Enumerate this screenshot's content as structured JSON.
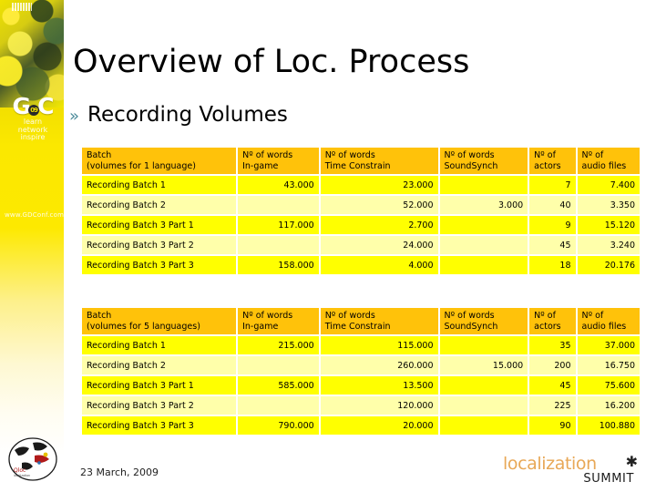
{
  "slide": {
    "title": "Overview of Loc. Process",
    "bullet_marker": "»",
    "bullet_text": "Recording Volumes",
    "date": "23 March, 2009"
  },
  "branding": {
    "gdc_name": "GDC",
    "gdc_badge": "09",
    "gdc_tagline_line1": "learn",
    "gdc_tagline_line2": "network",
    "gdc_tagline_line3": "inspire",
    "gdc_url": "www.GDConf.com",
    "summit_word1": "localization",
    "summit_word2": "SUMMIT",
    "accent_gold": "#ffc20a",
    "accent_yellow": "#ffff00",
    "accent_pale_yellow": "#ffffaa",
    "accent_bullet": "#4a8a99",
    "accent_orange": "#e8a857"
  },
  "table_one": {
    "headers": [
      {
        "line1": "Batch",
        "line2": "(volumes for 1 language)"
      },
      {
        "line1": "Nº of words",
        "line2": "In-game"
      },
      {
        "line1": "Nº of words",
        "line2": "Time Constrain"
      },
      {
        "line1": "Nº of words",
        "line2": "SoundSynch"
      },
      {
        "line1": "Nº of",
        "line2": "actors"
      },
      {
        "line1": "Nº of",
        "line2": "audio files"
      }
    ],
    "rows": [
      {
        "batch": "Recording Batch 1",
        "ingame": "43.000",
        "time": "23.000",
        "sound": "",
        "actors": "7",
        "audio": "7.400"
      },
      {
        "batch": "Recording Batch 2",
        "ingame": "",
        "time": "52.000",
        "sound": "3.000",
        "actors": "40",
        "audio": "3.350"
      },
      {
        "batch": "Recording Batch 3 Part 1",
        "ingame": "117.000",
        "time": "2.700",
        "sound": "",
        "actors": "9",
        "audio": "15.120"
      },
      {
        "batch": "Recording Batch 3 Part 2",
        "ingame": "",
        "time": "24.000",
        "sound": "",
        "actors": "45",
        "audio": "3.240"
      },
      {
        "batch": "Recording Batch 3 Part 3",
        "ingame": "158.000",
        "time": "4.000",
        "sound": "",
        "actors": "18",
        "audio": "20.176"
      }
    ]
  },
  "table_two": {
    "headers": [
      {
        "line1": "Batch",
        "line2": "(volumes for 5 languages)"
      },
      {
        "line1": "Nº of words",
        "line2": "In-game"
      },
      {
        "line1": "Nº of words",
        "line2": "Time Constrain"
      },
      {
        "line1": "Nº of words",
        "line2": "SoundSynch"
      },
      {
        "line1": "Nº of",
        "line2": "actors"
      },
      {
        "line1": "Nº of",
        "line2": "audio files"
      }
    ],
    "rows": [
      {
        "batch": "Recording Batch 1",
        "ingame": "215.000",
        "time": "115.000",
        "sound": "",
        "actors": "35",
        "audio": "37.000"
      },
      {
        "batch": "Recording Batch 2",
        "ingame": "",
        "time": "260.000",
        "sound": "15.000",
        "actors": "200",
        "audio": "16.750"
      },
      {
        "batch": "Recording Batch 3 Part 1",
        "ingame": "585.000",
        "time": "13.500",
        "sound": "",
        "actors": "45",
        "audio": "75.600"
      },
      {
        "batch": "Recording Batch 3 Part 2",
        "ingame": "",
        "time": "120.000",
        "sound": "",
        "actors": "225",
        "audio": "16.200"
      },
      {
        "batch": "Recording Batch 3 Part 3",
        "ingame": "790.000",
        "time": "20.000",
        "sound": "",
        "actors": "90",
        "audio": "100.880"
      }
    ]
  }
}
